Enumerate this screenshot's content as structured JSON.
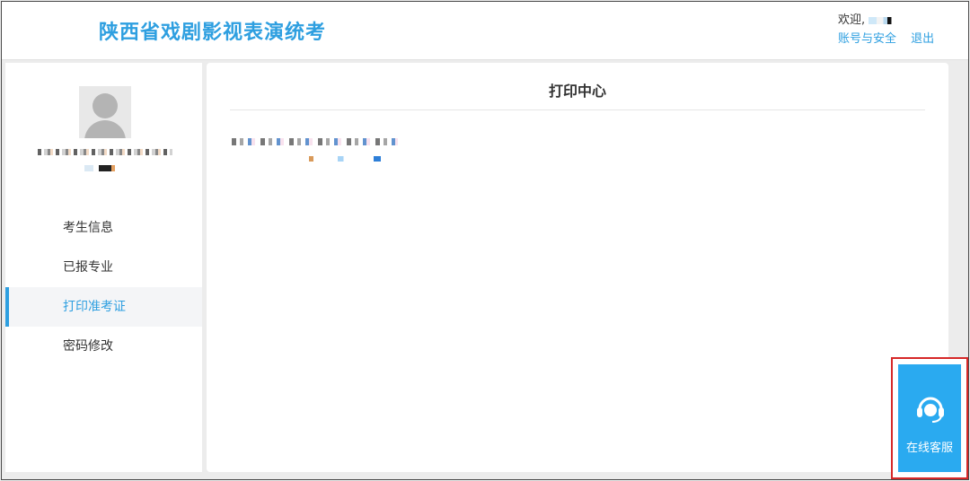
{
  "header": {
    "site_title": "陕西省戏剧影视表演统考",
    "welcome_label": "欢迎,",
    "account_security_link": "账号与安全",
    "logout_link": "退出"
  },
  "sidebar": {
    "avatar_icon": "user-avatar-placeholder",
    "items": [
      {
        "label": "考生信息",
        "active": false
      },
      {
        "label": "已报专业",
        "active": false
      },
      {
        "label": "打印准考证",
        "active": true
      },
      {
        "label": "密码修改",
        "active": false
      }
    ]
  },
  "main": {
    "title": "打印中心"
  },
  "service": {
    "label": "在线客服",
    "icon": "headset-icon"
  },
  "colors": {
    "accent": "#2e9fe0",
    "service_bg": "#2aaaf0",
    "highlight_border": "#d62828"
  }
}
